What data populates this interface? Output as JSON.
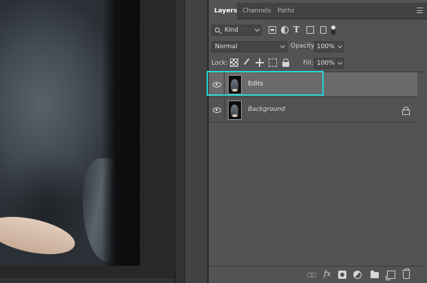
{
  "tabs": [
    {
      "label": "Layers",
      "active": true
    },
    {
      "label": "Channels",
      "active": false
    },
    {
      "label": "Paths",
      "active": false
    }
  ],
  "filter": {
    "kind_label": "Kind"
  },
  "blend": {
    "mode": "Normal",
    "opacity_label": "Opacity:",
    "opacity_value": "100%"
  },
  "lock": {
    "label": "Lock:",
    "fill_label": "Fill:",
    "fill_value": "100%"
  },
  "layers": [
    {
      "name": "Edits",
      "selected": true,
      "visible": true,
      "locked": false
    },
    {
      "name": "Background",
      "selected": false,
      "visible": true,
      "locked": true
    }
  ],
  "colors": {
    "highlight": "#21d8d8",
    "panel": "#535353",
    "selected_layer": "#6a6a6a"
  },
  "icons": {
    "filter": [
      "pixel-filter-icon",
      "adjustment-filter-icon",
      "type-filter-icon",
      "shape-filter-icon",
      "smart-object-filter-icon",
      "filter-toggle-icon"
    ],
    "lock": [
      "lock-transparent-pixels-icon",
      "lock-image-pixels-icon",
      "lock-position-icon",
      "lock-artboard-icon",
      "lock-all-icon"
    ],
    "bottom": [
      "link-layers-icon",
      "fx-icon",
      "add-mask-icon",
      "new-adjustment-layer-icon",
      "new-group-icon",
      "new-layer-icon",
      "delete-layer-icon"
    ]
  }
}
